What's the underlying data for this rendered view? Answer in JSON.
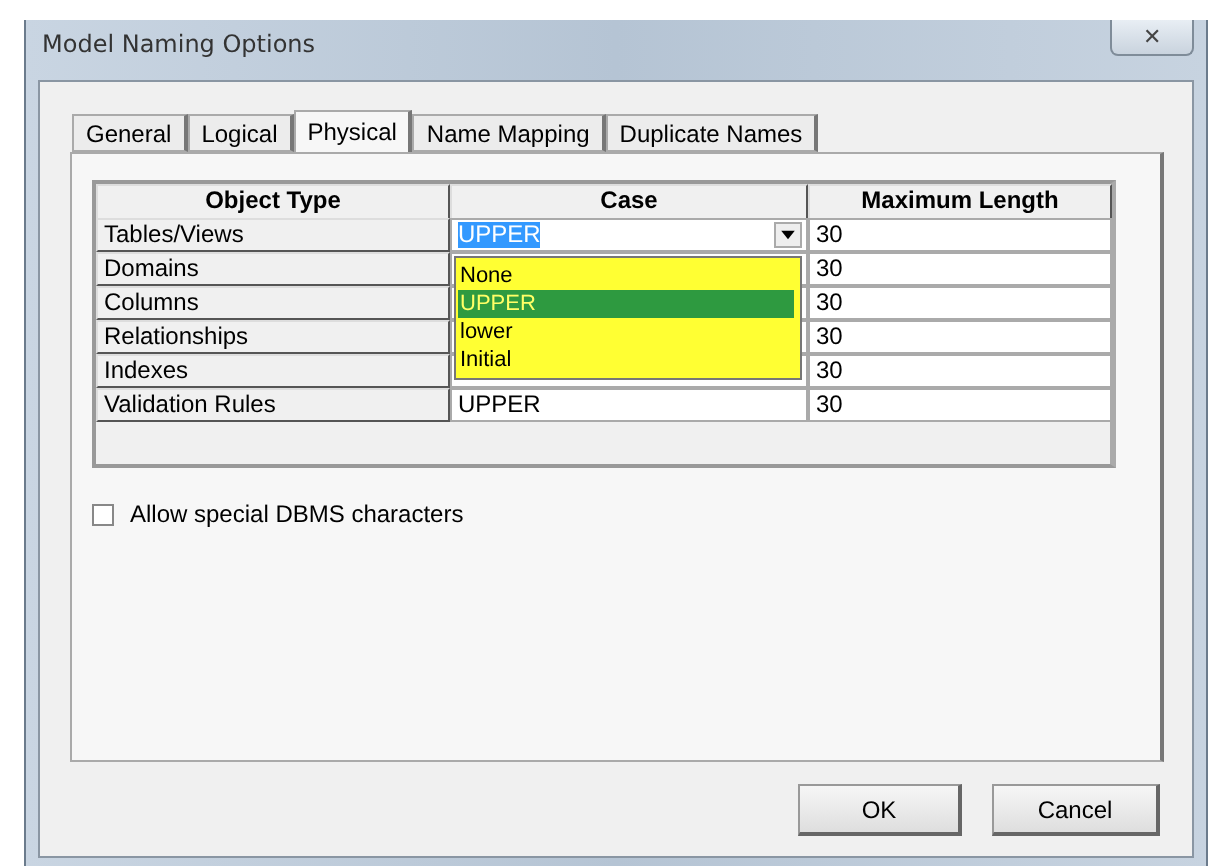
{
  "window": {
    "title": "Model Naming Options",
    "close": "✕"
  },
  "tabs": [
    {
      "label": "General",
      "selected": false
    },
    {
      "label": "Logical",
      "selected": false
    },
    {
      "label": "Physical",
      "selected": true
    },
    {
      "label": "Name Mapping",
      "selected": false
    },
    {
      "label": "Duplicate Names",
      "selected": false
    }
  ],
  "table": {
    "columns": [
      "Object Type",
      "Case",
      "Maximum Length"
    ],
    "rows": [
      {
        "object_type": "Tables/Views",
        "case": "UPPER",
        "max_length": "30",
        "editing": true
      },
      {
        "object_type": "Domains",
        "max_length": "30",
        "editing": false
      },
      {
        "object_type": "Columns",
        "max_length": "30",
        "editing": false
      },
      {
        "object_type": "Relationships",
        "max_length": "30",
        "editing": false
      },
      {
        "object_type": "Indexes",
        "max_length": "30",
        "editing": false
      },
      {
        "object_type": "Validation Rules",
        "case": "UPPER",
        "max_length": "30",
        "editing": false
      }
    ],
    "dropdown_options": [
      {
        "label": "None",
        "selected": false
      },
      {
        "label": "UPPER",
        "selected": true
      },
      {
        "label": "lower",
        "selected": false
      },
      {
        "label": "Initial",
        "selected": false
      }
    ]
  },
  "allow_special_dbms_characters": {
    "label": "Allow special DBMS characters",
    "checked": false
  },
  "buttons": [
    "OK",
    "Cancel"
  ]
}
